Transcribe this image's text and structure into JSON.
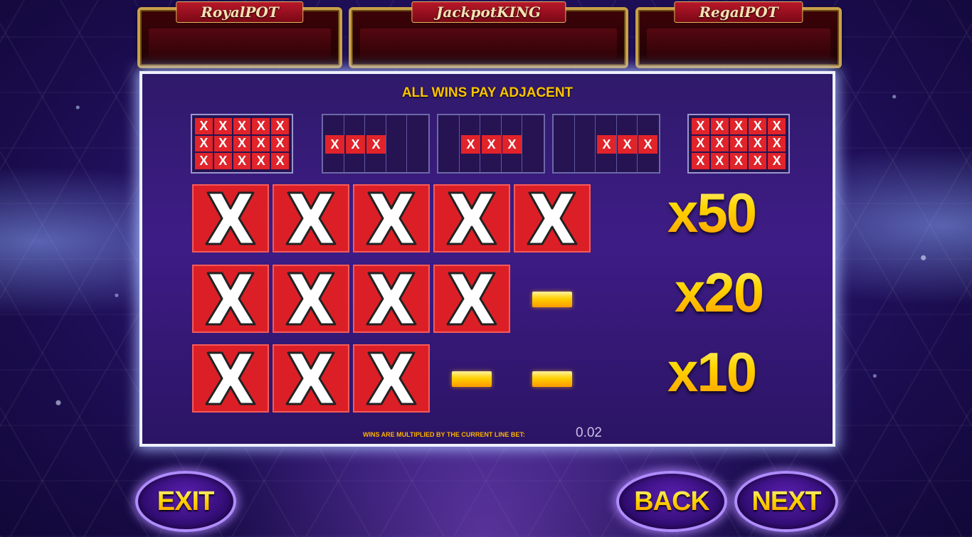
{
  "jackpots": {
    "left": {
      "name": "RoyalPOT"
    },
    "middle": {
      "name": "JackpotKING"
    },
    "right": {
      "name": "RegalPOT"
    }
  },
  "paytable": {
    "title": "ALL WINS PAY ADJACENT",
    "patterns": [
      {
        "type": "full",
        "symbol": "X"
      },
      {
        "type": "line",
        "position": "left",
        "symbols": [
          "X",
          "X",
          "X"
        ]
      },
      {
        "type": "line",
        "position": "center",
        "symbols": [
          "X",
          "X",
          "X"
        ]
      },
      {
        "type": "line",
        "position": "right",
        "symbols": [
          "X",
          "X",
          "X"
        ]
      },
      {
        "type": "full",
        "symbol": "X"
      }
    ],
    "rows": [
      {
        "symbols": 5,
        "multiplier": "x50"
      },
      {
        "symbols": 4,
        "multiplier": "x20"
      },
      {
        "symbols": 3,
        "multiplier": "x10"
      }
    ],
    "symbol_label": "X",
    "footnote": "WINS ARE MULTIPLIED BY THE CURRENT LINE BET:",
    "line_bet": "0.02"
  },
  "buttons": {
    "exit": "EXIT",
    "back": "BACK",
    "next": "NEXT"
  },
  "colors": {
    "symbol_red": "#dc1f26",
    "gold": "#ffd21a",
    "panel_purple": "#3e1c86",
    "jackpot_maroon": "#3d0308"
  }
}
